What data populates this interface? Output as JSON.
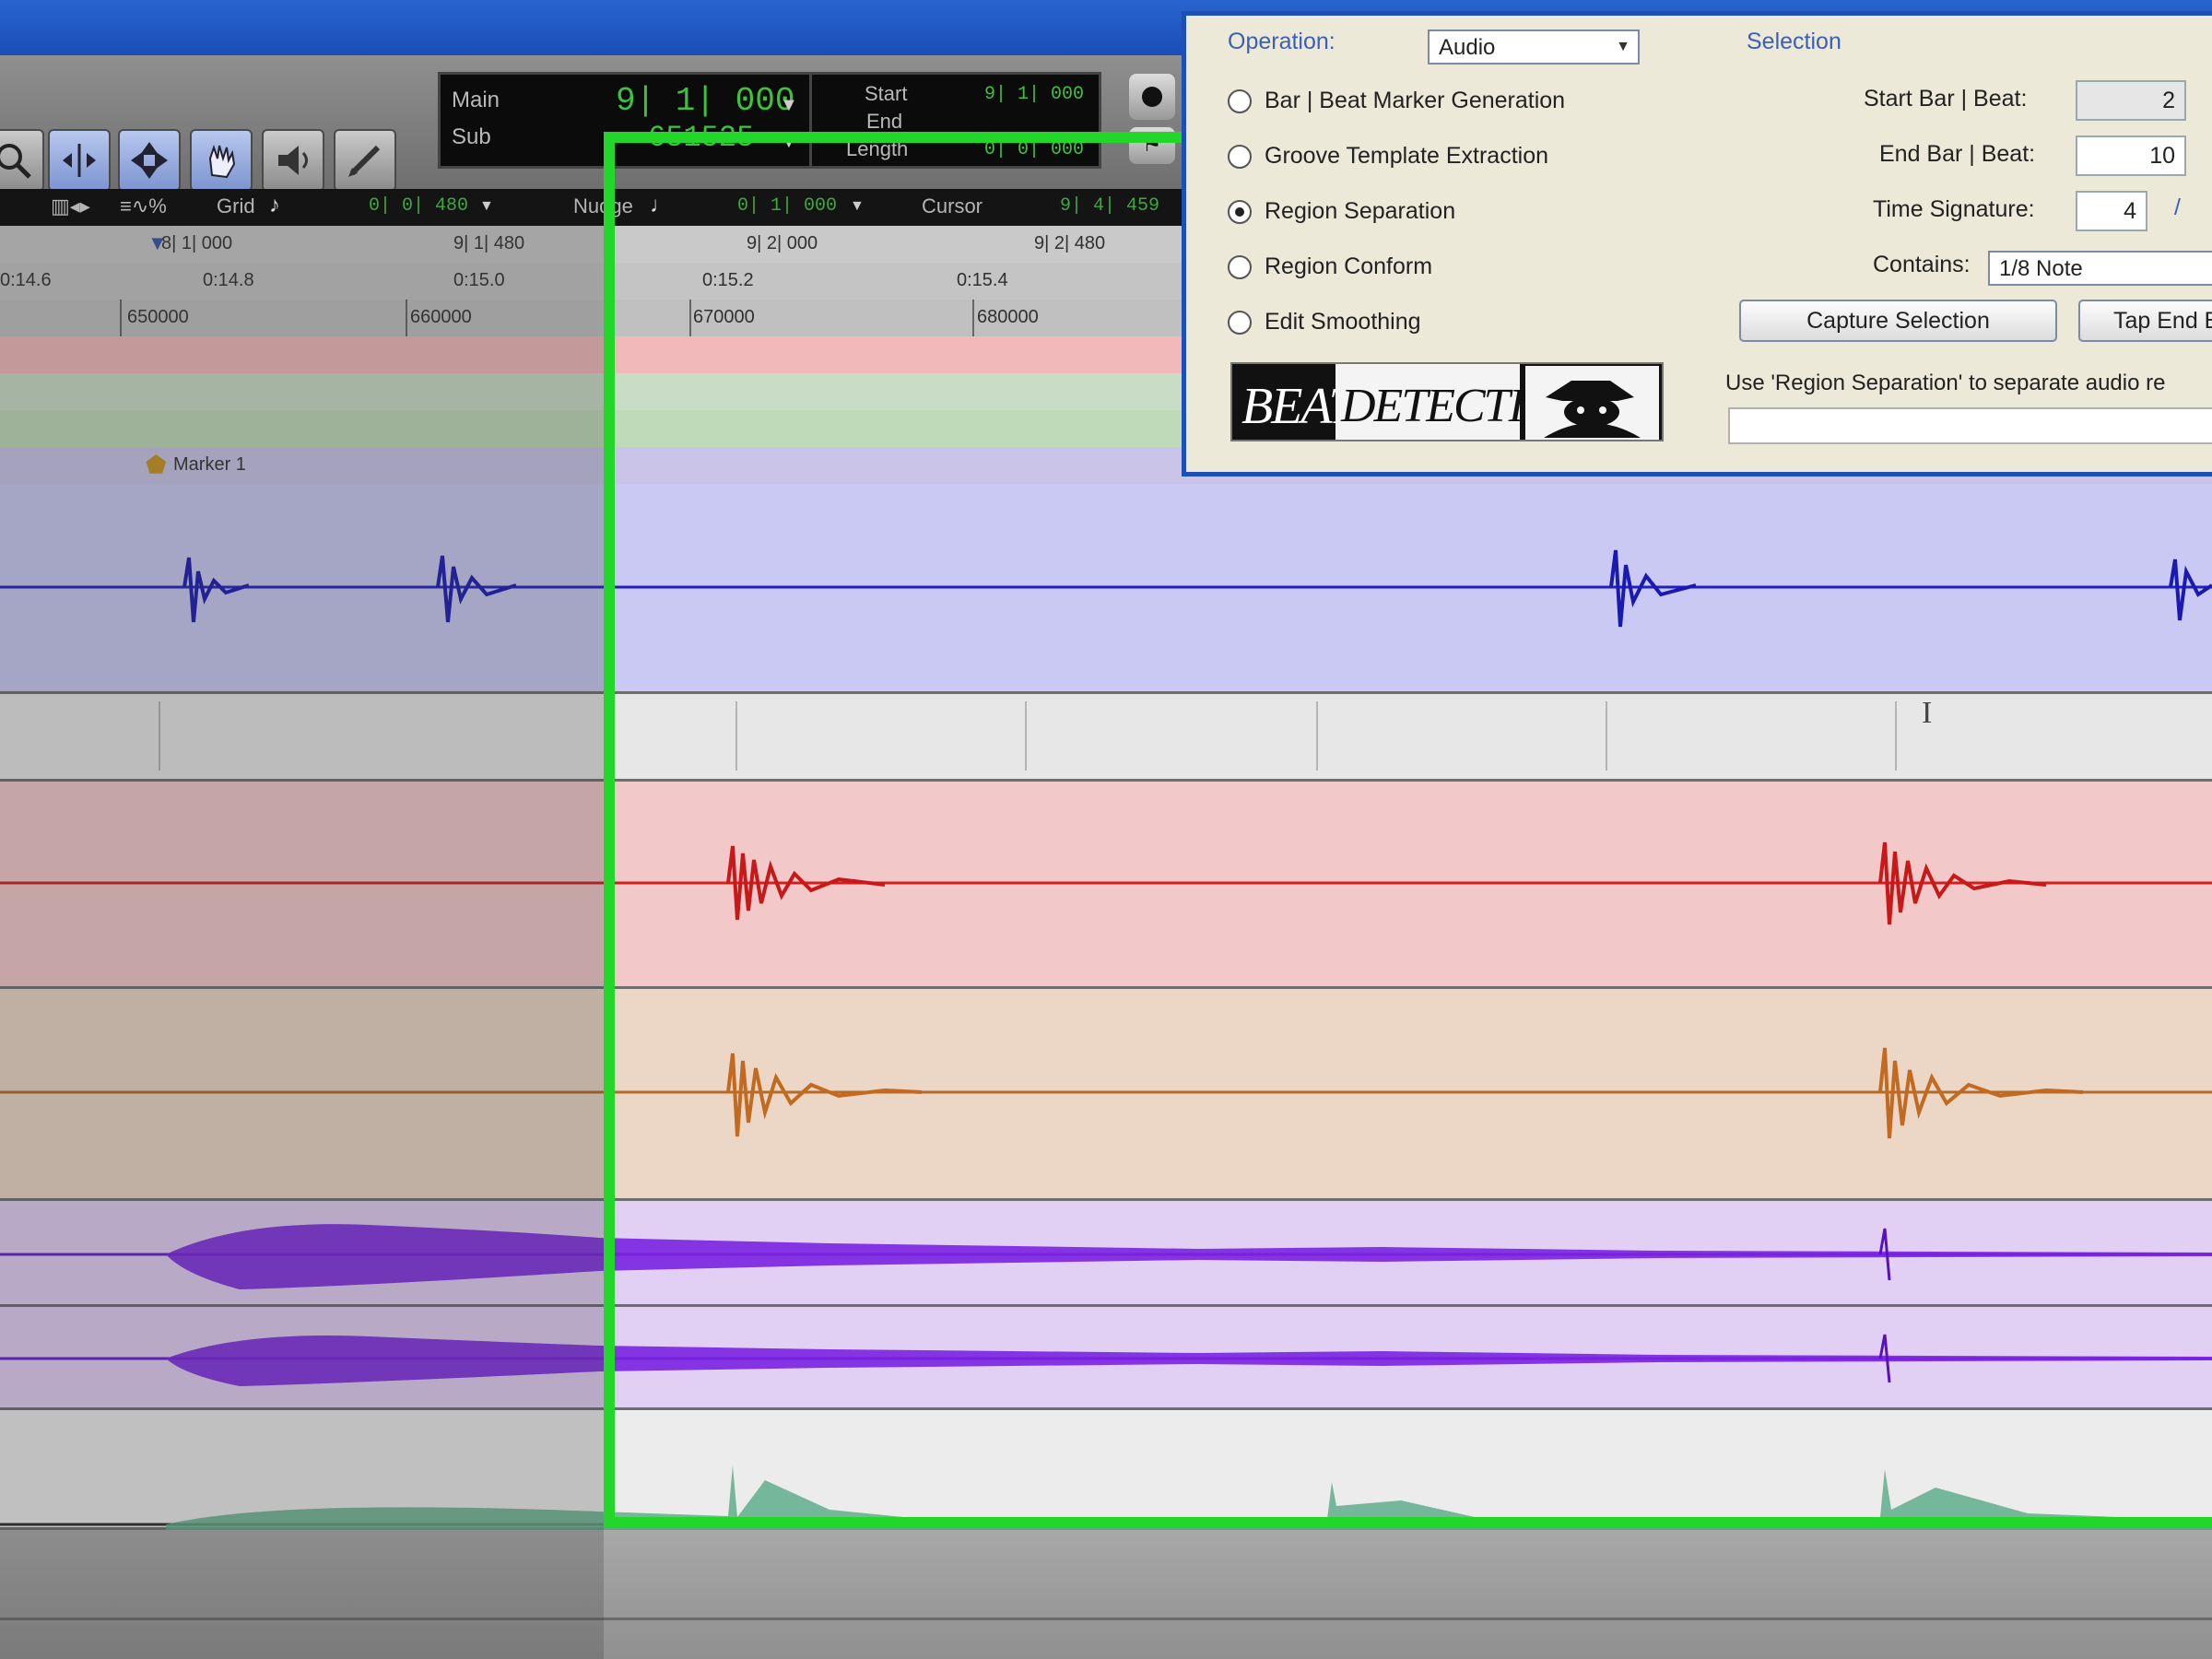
{
  "toolbar": {
    "tools": [
      "zoomer-tool",
      "trim-tool",
      "selector-tool",
      "grabber-tool",
      "scrubber-tool",
      "pencil-tool"
    ],
    "counter": {
      "main_label": "Main",
      "sub_label": "Sub",
      "main_value": "9| 1| 000",
      "sub_value": "651525",
      "start_label": "Start",
      "end_label": "End",
      "length_label": "Length",
      "start_value": "9| 1| 000",
      "length_value": "0| 0| 000"
    },
    "grid_label": "Grid",
    "grid_value": "0| 0| 480",
    "nudge_label": "Nudge",
    "nudge_value": "0| 1| 000",
    "cursor_label": "Cursor",
    "cursor_value": "9| 4| 459"
  },
  "rulers": {
    "bars": [
      "8| 1| 000",
      "9| 1| 480",
      "9| 2| 000",
      "9| 2| 480"
    ],
    "minsecs": [
      "0:14.6",
      "0:14.8",
      "0:15.0",
      "0:15.2",
      "0:15.4"
    ],
    "samples": [
      "650000",
      "660000",
      "670000",
      "680000"
    ]
  },
  "marker": {
    "label": "Marker 1"
  },
  "dialog": {
    "operation_label": "Operation:",
    "operation_value": "Audio",
    "selection_label": "Selection",
    "options": [
      {
        "label": "Bar | Beat Marker Generation",
        "selected": false
      },
      {
        "label": "Groove Template Extraction",
        "selected": false
      },
      {
        "label": "Region Separation",
        "selected": true
      },
      {
        "label": "Region Conform",
        "selected": false
      },
      {
        "label": "Edit Smoothing",
        "selected": false
      }
    ],
    "start_label": "Start Bar | Beat:",
    "start_value": "2",
    "end_label": "End Bar | Beat:",
    "end_value": "10",
    "timesig_label": "Time Signature:",
    "timesig_value": "4",
    "timesig_sep": "/",
    "contains_label": "Contains:",
    "contains_value": "1/8 Note",
    "capture_button": "Capture Selection",
    "tap_end_button": "Tap End B",
    "hint": "Use 'Region Separation' to separate audio re",
    "logo_left": "BEAT",
    "logo_right": "DETECTIVE"
  }
}
